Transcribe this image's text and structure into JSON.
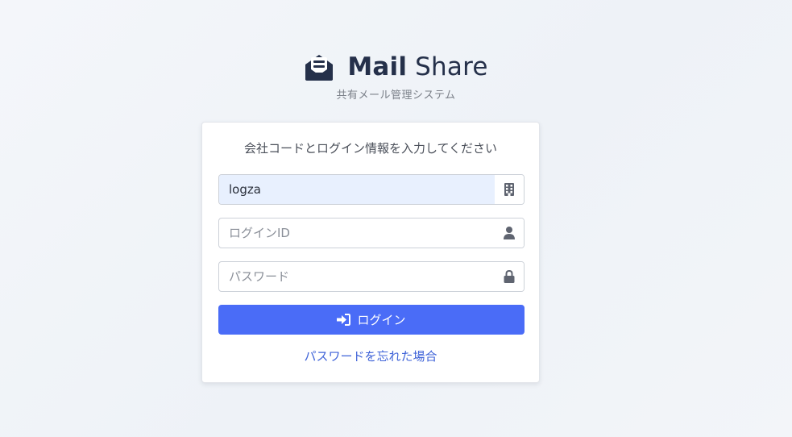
{
  "brand": {
    "icon": "envelope-open-text-icon",
    "title_strong": "Mail",
    "title_light": "Share",
    "subtitle": "共有メール管理システム",
    "color": "#25304a"
  },
  "login_card": {
    "heading": "会社コードとログイン情報を入力してください",
    "company_code": {
      "value": "logza",
      "placeholder": "",
      "icon": "building-icon"
    },
    "login_id": {
      "value": "",
      "placeholder": "ログインID",
      "icon": "user-icon"
    },
    "password": {
      "value": "",
      "placeholder": "パスワード",
      "icon": "lock-icon"
    },
    "submit": {
      "label": "ログイン",
      "icon": "sign-in-icon",
      "color": "#4a6cf7"
    },
    "forgot_password": "パスワードを忘れた場合"
  }
}
